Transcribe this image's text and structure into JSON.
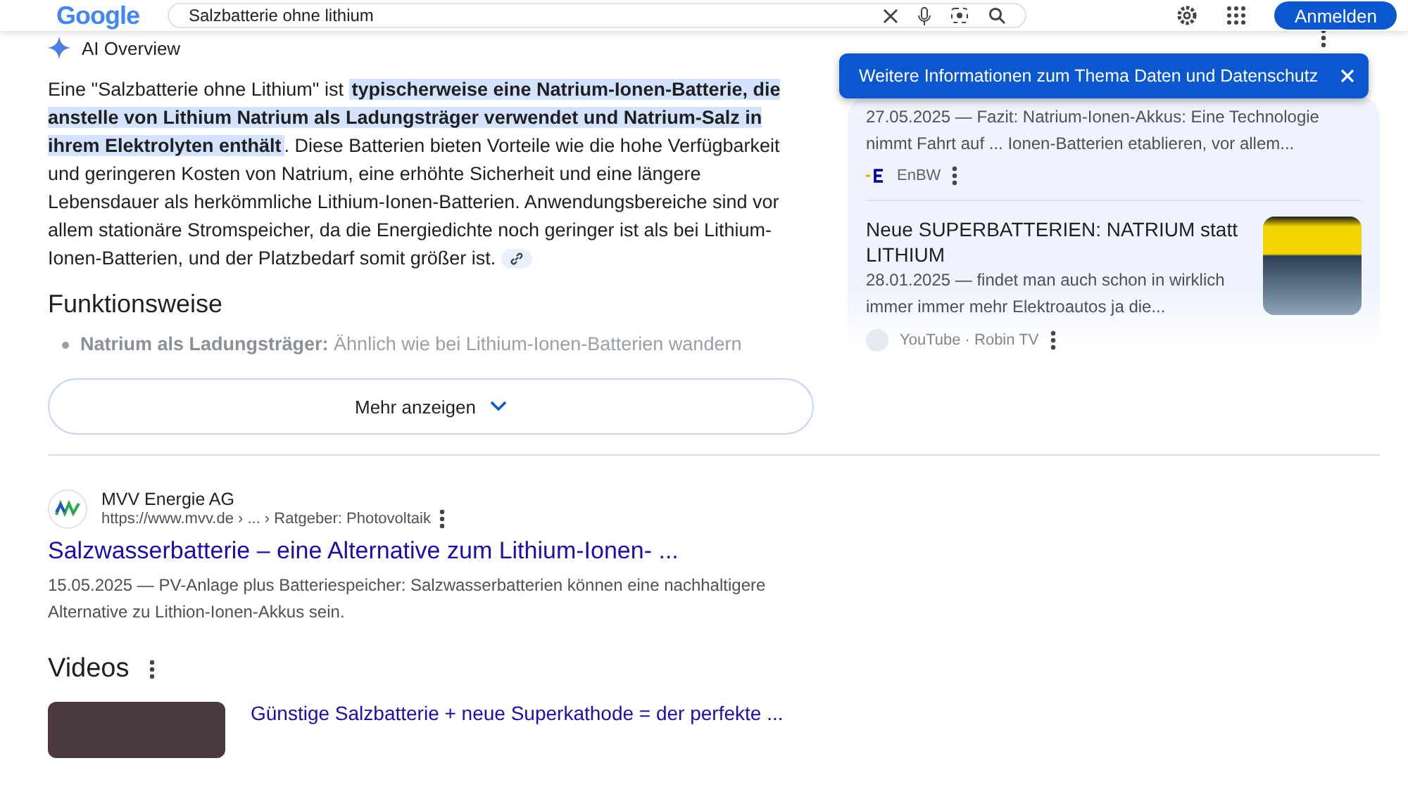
{
  "header": {
    "logo": "Google",
    "search": {
      "value": "Salzbatterie ohne lithium"
    },
    "signin_button": "Anmelden"
  },
  "ai_overview": {
    "label": "AI Overview",
    "summary": "Eine \"Salzbatterie ohne Lithium\" ist **typischerweise eine Natrium-Ionen-Batterie, die anstelle von Lithium Natrium als Ladungsträger verwendet und Natrium-Salz in ihrem Elektrolyten enthält**. Diese Batterien bieten Vorteile wie die hohe Verfügbarkeit und geringeren Kosten von Natrium, eine erhöhte Sicherheit und eine längere Lebensdauer als herkömmliche Lithium-Ionen-Batterien. Anwendungsbereiche sind vor allem stationäre Stromspeicher, da die Energiedichte noch geringer ist als bei Lithium-Ionen-Batterien, und der Platzbedarf somit größer ist.",
    "section_heading": "Funktionsweise",
    "bullets": [
      "**Natrium als Ladungsträger:** Ähnlich wie bei Lithium-Ionen-Batterien wandern"
    ],
    "more_button": "Mehr anzeigen",
    "sources": [
      {
        "kind": "text",
        "snippet": "27.05.2025 — Fazit: Natrium-Ionen-Akkus: Eine Technologie nimmt Fahrt auf ... Ionen-Batterien etablieren, vor allem...",
        "source": "EnBW",
        "faded": false
      },
      {
        "kind": "video",
        "title": "Neue SUPERBATTERIEN: NATRIUM statt LITHIUM",
        "snippet": "28.01.2025 — findet man auch schon in wirklich immer immer mehr Elektroautos ja die...",
        "source": "YouTube · Robin TV",
        "faded": true
      }
    ],
    "tooltip": {
      "text": "Weitere Informationen zum Thema Daten und Datenschutz"
    }
  },
  "result": {
    "site": "MVV Energie AG",
    "url": "https://www.mvv.de › ... › Ratgeber: Photovoltaik",
    "title": "Salzwasserbatterie – eine Alternative zum Lithium-Ionen- ...",
    "snippet": "15.05.2025 — PV-Anlage plus Batteriespeicher: Salzwasserbatterien können eine nachhaltigere Alternative zu Lithion-Ionen-Akkus sein."
  },
  "videos": {
    "heading": "Videos",
    "items": [
      {
        "title": "Günstige Salzbatterie + neue Superkathode = der perfekte ..."
      }
    ]
  }
}
